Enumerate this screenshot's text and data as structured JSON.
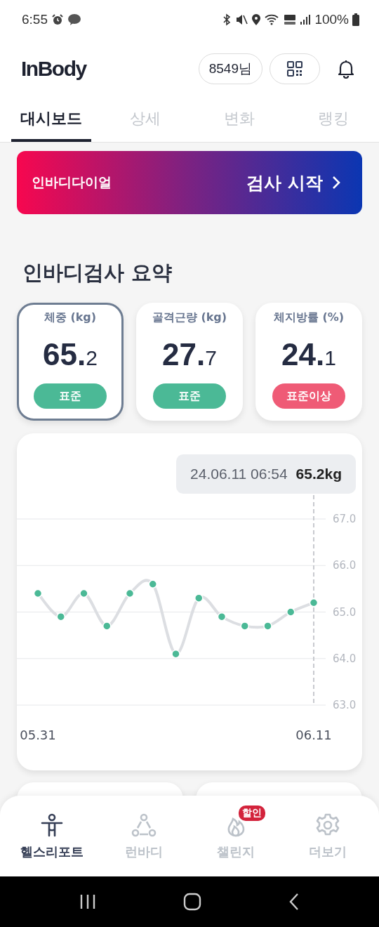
{
  "status_bar": {
    "time": "6:55",
    "battery": "100%"
  },
  "header": {
    "logo": "InBody",
    "user": "8549님"
  },
  "tabs": [
    {
      "label": "대시보드",
      "selected": true
    },
    {
      "label": "상세",
      "selected": false
    },
    {
      "label": "변화",
      "selected": false
    },
    {
      "label": "랭킹",
      "selected": false
    }
  ],
  "banner": {
    "label": "인바디다이얼",
    "action": "검사 시작"
  },
  "summary": {
    "title": "인바디검사 요약",
    "cards": [
      {
        "label": "체중 (kg)",
        "whole": "65.",
        "decimal": "2",
        "status": "표준",
        "color": "#4bb996",
        "selected": true
      },
      {
        "label": "골격근량 (kg)",
        "whole": "27.",
        "decimal": "7",
        "status": "표준",
        "color": "#4bb996",
        "selected": false
      },
      {
        "label": "체지방률 (%)",
        "whole": "24.",
        "decimal": "1",
        "status": "표준이상",
        "color": "#ef5b76",
        "selected": false
      }
    ]
  },
  "trend": {
    "tooltip": {
      "date": "24.06.11 06:54",
      "value": "65.2kg"
    },
    "chart_data": {
      "type": "line",
      "categories": [
        "05.31",
        null,
        null,
        null,
        null,
        null,
        null,
        null,
        null,
        null,
        null,
        null,
        "06.11"
      ],
      "grid": true,
      "series": [
        {
          "color": "#dcdee2",
          "marker": "circle",
          "values": [
            65.4,
            64.9,
            65.4,
            64.7,
            65.4,
            65.6,
            64.1,
            65.3,
            64.9,
            64.7,
            64.7,
            65.0,
            65.2
          ]
        }
      ],
      "ylim": [
        63,
        67
      ],
      "yticks": [
        {
          "value": 63,
          "label": "63.0"
        },
        {
          "value": 64,
          "label": "64.0"
        },
        {
          "value": 65,
          "label": "65.0"
        },
        {
          "value": 66,
          "label": "66.0"
        },
        {
          "value": 67,
          "label": "67.0"
        }
      ]
    }
  },
  "bottom_nav": [
    {
      "label": "헬스리포트",
      "selected": true
    },
    {
      "label": "런바디",
      "selected": false
    },
    {
      "label": "챌린지",
      "selected": false,
      "badge": "할인"
    },
    {
      "label": "더보기",
      "selected": false
    }
  ]
}
